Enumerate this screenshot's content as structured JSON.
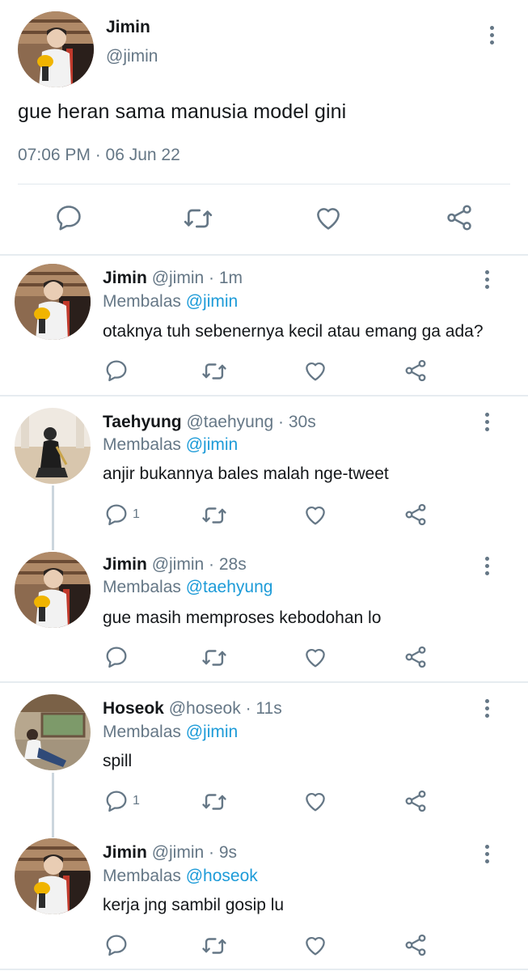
{
  "main_tweet": {
    "name": "Jimin",
    "handle": "@jimin",
    "text": "gue heran sama manusia model gini",
    "timestamp": "07:06 PM · 06 Jun 22",
    "icons": [
      "reply-icon",
      "retweet-icon",
      "like-icon",
      "share-icon"
    ]
  },
  "replies": [
    {
      "name": "Jimin",
      "handle": "@jimin",
      "time": "· 1m",
      "reply_label": "Membalas",
      "reply_to": "@jimin",
      "text": "otaknya tuh sebenernya kecil atau emang ga ada?",
      "reply_count": ""
    },
    {
      "name": "Taehyung",
      "handle": "@taehyung",
      "time": "· 30s",
      "reply_label": "Membalas",
      "reply_to": "@jimin",
      "text": "anjir bukannya bales malah nge-tweet",
      "reply_count": "1"
    },
    {
      "name": "Jimin",
      "handle": "@jimin",
      "time": "· 28s",
      "reply_label": "Membalas",
      "reply_to": "@taehyung",
      "text": "gue masih memproses kebodohan lo",
      "reply_count": ""
    },
    {
      "name": "Hoseok",
      "handle": "@hoseok",
      "time": "· 11s",
      "reply_label": "Membalas",
      "reply_to": "@jimin",
      "text": "spill",
      "reply_count": "1"
    },
    {
      "name": "Jimin",
      "handle": "@jimin",
      "time": "· 9s",
      "reply_label": "Membalas",
      "reply_to": "@hoseok",
      "text": "kerja jng sambil gosip lu",
      "reply_count": ""
    }
  ],
  "colors": {
    "text": "#14171a",
    "muted": "#657786",
    "link": "#1d9bd8",
    "divider": "#e6ecf0"
  }
}
